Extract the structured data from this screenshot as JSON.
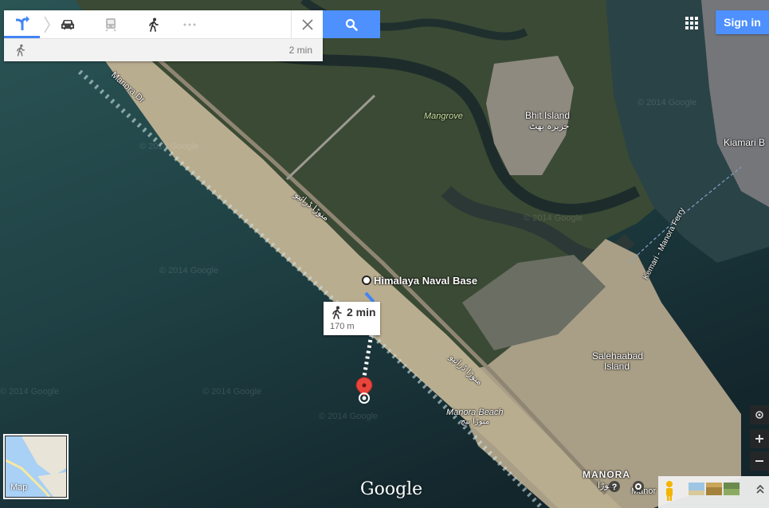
{
  "directions_panel": {
    "modes": [
      {
        "name": "directions",
        "icon": "directions-icon"
      },
      {
        "name": "driving",
        "icon": "car-icon"
      },
      {
        "name": "transit",
        "icon": "train-icon"
      },
      {
        "name": "walking",
        "icon": "walking-icon"
      },
      {
        "name": "more",
        "icon": "more-icon"
      }
    ],
    "summary_time": "2 min"
  },
  "search_button": {
    "icon": "search-icon"
  },
  "sign_in_label": "Sign in",
  "route": {
    "origin_label": "Himalaya Naval Base",
    "time": "2 min",
    "distance": "170 m"
  },
  "places": {
    "manora_dr": "Manora Dr",
    "mangrove": "Mangrove",
    "bhit_island": "Bhit Island",
    "bhit_island_urdu": "جزیرہ بھٹ",
    "kiamari": "Kiamari B",
    "manora_ferry": "Kemari - Manora Ferry",
    "urdu_road_1": "منوڑا ڈرائیو",
    "urdu_road_2": "منوڑا ڈرائیو",
    "salehaabad_1": "Salehaabad",
    "salehaabad_2": "Island",
    "manora_beach": "Manora Beach",
    "manora_beach_urdu": "منوڑا بیچ",
    "manora": "MANORA",
    "manora_urdu": "منوڑا",
    "manor_partial": "Manor"
  },
  "watermark": "© 2014 Google",
  "minimap_label": "Map",
  "google_logo": "Google",
  "colors": {
    "accent_blue": "#4d90fe",
    "route_pin": "#e8453c",
    "sea": "#1e4347",
    "mangrove": "#3a4a33",
    "land": "#a89d85"
  }
}
